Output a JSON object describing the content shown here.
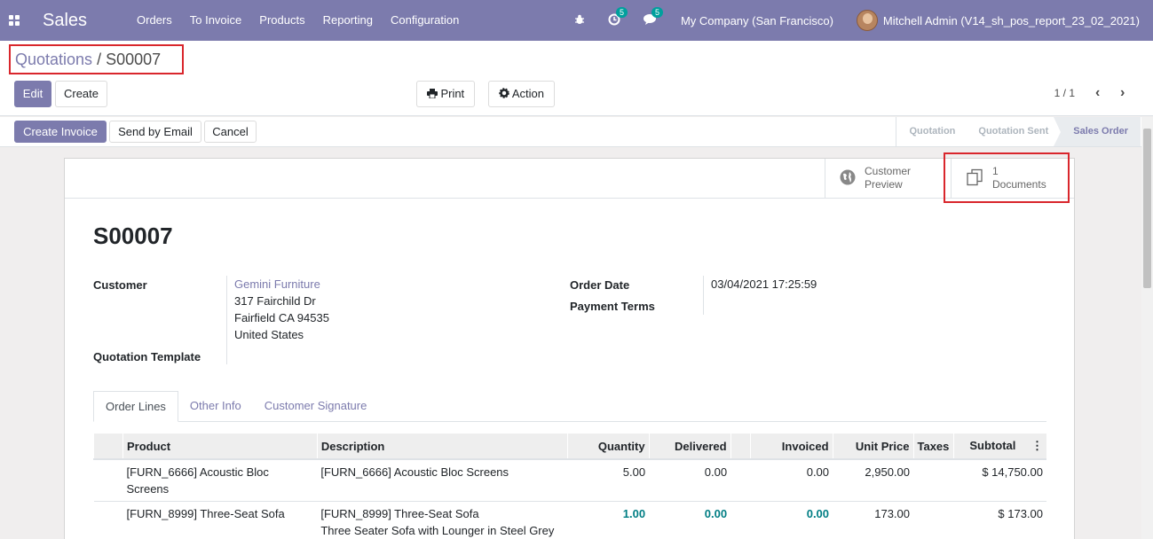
{
  "navbar": {
    "app": "Sales",
    "menu": [
      "Orders",
      "To Invoice",
      "Products",
      "Reporting",
      "Configuration"
    ],
    "activity_count": "5",
    "message_count": "5",
    "company": "My Company (San Francisco)",
    "user": "Mitchell Admin (V14_sh_pos_report_23_02_2021)",
    "colors": {
      "brand": "#7c7bad",
      "badge": "#00a09d",
      "highlight_border": "#d9262c"
    }
  },
  "breadcrumb": {
    "parent": "Quotations",
    "separator": " / ",
    "current": "S00007"
  },
  "actions": {
    "edit": "Edit",
    "create": "Create",
    "print": "Print",
    "action": "Action"
  },
  "pager": {
    "value": "1 / 1"
  },
  "status_buttons": {
    "create_invoice": "Create Invoice",
    "send_email": "Send by Email",
    "cancel": "Cancel"
  },
  "stages": [
    "Quotation",
    "Quotation Sent",
    "Sales Order"
  ],
  "active_stage": "Sales Order",
  "smart_buttons": {
    "preview_line1": "Customer",
    "preview_line2": "Preview",
    "docs_count": "1",
    "docs_label": "Documents"
  },
  "order": {
    "name": "S00007",
    "customer_label": "Customer",
    "customer_name": "Gemini Furniture",
    "address1": "317 Fairchild Dr",
    "address2": "Fairfield CA 94535",
    "address3": "United States",
    "template_label": "Quotation Template",
    "date_label": "Order Date",
    "date_value": "03/04/2021 17:25:59",
    "terms_label": "Payment Terms"
  },
  "tabs": [
    "Order Lines",
    "Other Info",
    "Customer Signature"
  ],
  "table": {
    "headers": [
      "Product",
      "Description",
      "Quantity",
      "Delivered",
      "Invoiced",
      "Unit Price",
      "Taxes",
      "Subtotal"
    ],
    "rows": [
      {
        "product": "[FURN_6666] Acoustic Bloc Screens",
        "description": "[FURN_6666] Acoustic Bloc Screens",
        "description2": "",
        "quantity": "5.00",
        "delivered": "0.00",
        "invoiced": "0.00",
        "unit_price": "2,950.00",
        "taxes": "",
        "subtotal": "$ 14,750.00"
      },
      {
        "product": "[FURN_8999] Three-Seat Sofa",
        "description": "[FURN_8999] Three-Seat Sofa",
        "description2": "Three Seater Sofa with Lounger in Steel Grey Colour",
        "quantity": "1.00",
        "delivered": "0.00",
        "invoiced": "0.00",
        "unit_price": "173.00",
        "taxes": "",
        "subtotal": "$ 173.00"
      }
    ]
  }
}
